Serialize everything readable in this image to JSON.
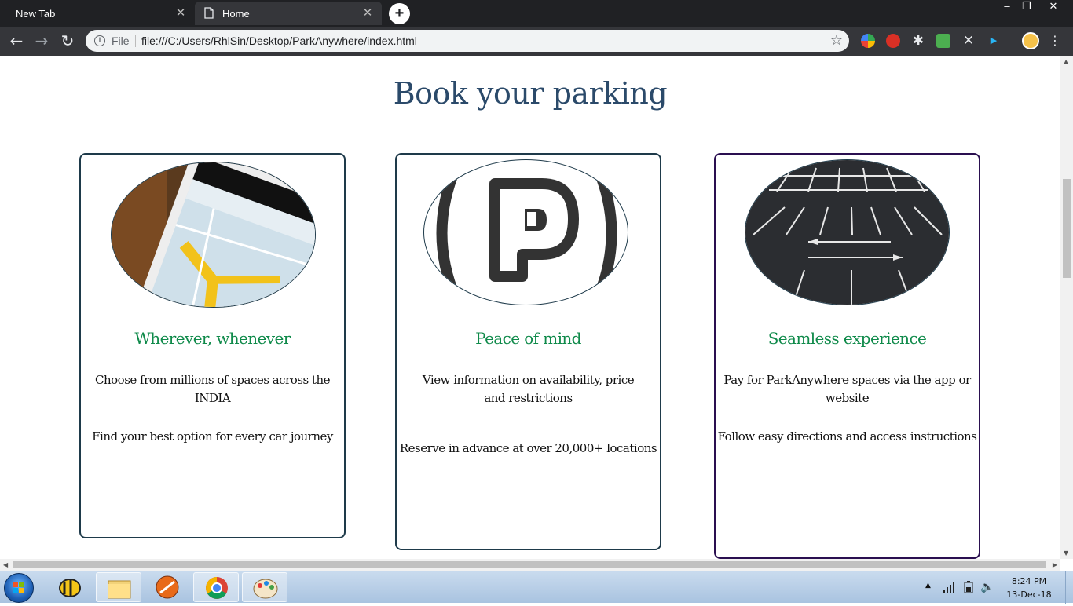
{
  "browser": {
    "tabs": [
      {
        "label": "New Tab"
      },
      {
        "label": "Home"
      }
    ],
    "omnibox": {
      "scheme_label": "File",
      "url": "file:///C:/Users/RhlSin/Desktop/ParkAnywhere/index.html"
    },
    "window_controls": {
      "minimize": "–",
      "restore": "❐",
      "close": "✕"
    }
  },
  "page": {
    "title": "Book your parking",
    "cards": [
      {
        "image": "phone-map-photo",
        "heading": "Wherever, whenever",
        "text1": "Choose from millions of spaces across the INDIA",
        "text2": "Find your best option for every car journey"
      },
      {
        "image": "parking-p-sign",
        "heading": "Peace of mind",
        "text1": "View information on availability, price and restrictions",
        "text2": "Reserve in advance at over 20,000+ locations"
      },
      {
        "image": "parking-lot-photo",
        "heading": "Seamless experience",
        "text1": "Pay for ParkAnywhere spaces via the app or website",
        "text2": "Follow easy directions and access instructions"
      }
    ]
  },
  "taskbar": {
    "clock_time": "8:24 PM",
    "clock_date": "13-Dec-18",
    "pinned": [
      "bee-app-icon",
      "file-explorer-icon",
      "media-player-icon",
      "chrome-icon",
      "paint-icon"
    ]
  },
  "colors": {
    "title": "#2b4a6a",
    "heading": "#0f8a4a",
    "card_border": "#1e3a4a",
    "card3_border": "#2a0f50",
    "tab_bar": "#202124",
    "toolbar": "#35363a"
  }
}
